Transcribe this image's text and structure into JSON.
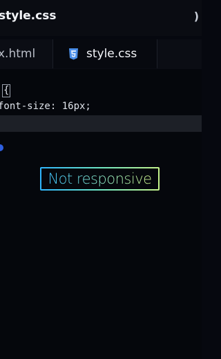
{
  "window": {
    "title": "style.css"
  },
  "tabs": [
    {
      "label": "x.html"
    },
    {
      "label": "style.css"
    }
  ],
  "code": {
    "line1": "{",
    "line2": "font-size: 16px;"
  },
  "overlay": {
    "label": "Not responsive"
  },
  "colors": {
    "accent_blue": "#2e5fe0",
    "badge_gradient_start": "#2fb6ff",
    "badge_gradient_end": "#c4f28a"
  }
}
